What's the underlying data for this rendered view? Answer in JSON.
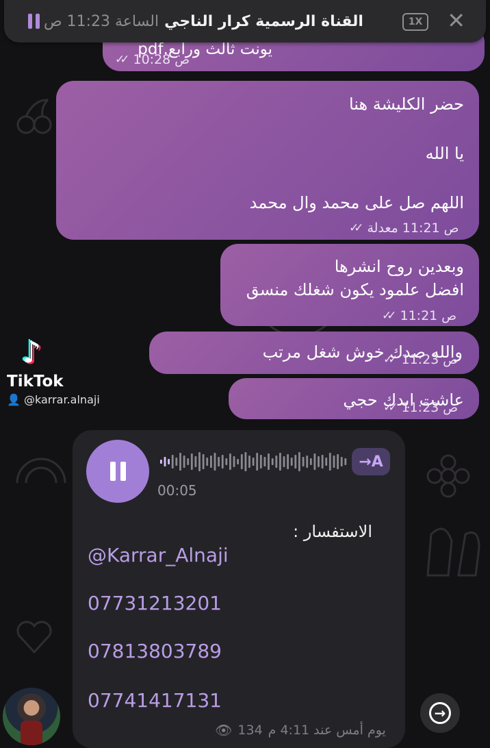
{
  "player": {
    "title": "القناة الرسمية كرار الناجي",
    "time_label": "الساعة 11:23 ص",
    "speed": "1X",
    "close_icon": "close-icon",
    "pause_icon": "pause-icon"
  },
  "messages": [
    {
      "text": "يونت ثالث ورابع.pdf",
      "time": "10:28",
      "ampm": "ص",
      "edited": ""
    },
    {
      "lines": [
        "حضر الكليشة هنا",
        "",
        "يا الله",
        "",
        "اللهم صل على محمد وال محمد"
      ],
      "time": "11:21",
      "ampm": "ص",
      "edited": "معدلة"
    },
    {
      "lines": [
        "وبعدين روح انشرها",
        "افضل علمود يكون شغلك منسق"
      ],
      "time": "11:21",
      "ampm": "ص"
    },
    {
      "text": "والله صدك خوش شغل مرتب",
      "time": "11:23",
      "ampm": "ص"
    },
    {
      "text": "عاشت ايدك حجي",
      "time": "11:23",
      "ampm": "ص"
    }
  ],
  "tiktok": {
    "brand": "TikTok",
    "handle": "@karrar.alnaji"
  },
  "voice_message": {
    "duration": "00:05",
    "transcribe_label": "→A",
    "inquiry": "الاستفسار :",
    "contact_lines": [
      "@Karrar_Alnaji",
      "07731213201",
      "07813803789",
      "07741417131"
    ],
    "views": "134",
    "date_label": "يوم أمس عند 4:11 م"
  },
  "colors": {
    "bubble": "#8e57a0",
    "accent": "#a27fd7",
    "background": "#121214"
  }
}
